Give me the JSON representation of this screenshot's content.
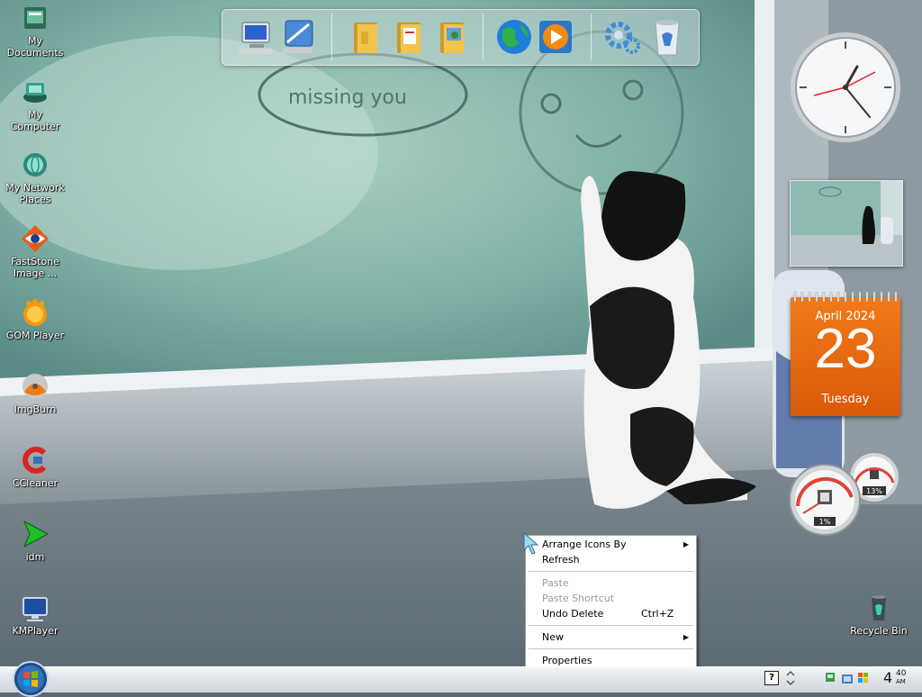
{
  "desktop_icons": [
    {
      "label": "My\nDocuments",
      "icon": "folder-documents-icon"
    },
    {
      "label": "My\nComputer",
      "icon": "computer-icon"
    },
    {
      "label": "My Network\nPlaces",
      "icon": "network-globe-icon"
    },
    {
      "label": "FastStone\nImage ...",
      "icon": "faststone-eye-icon"
    },
    {
      "label": "GOM Player",
      "icon": "gom-player-icon"
    },
    {
      "label": "ImgBurn",
      "icon": "imgburn-disc-icon"
    },
    {
      "label": "CCleaner",
      "icon": "ccleaner-icon"
    },
    {
      "label": "idm",
      "icon": "idm-arrow-icon"
    },
    {
      "label": "KMPlayer",
      "icon": "kmplayer-icon"
    }
  ],
  "recycle_bin": {
    "label": "Recycle Bin"
  },
  "wallpaper": {
    "drawn_text": "missing you"
  },
  "dock": {
    "items": [
      "my-computer-icon",
      "control-panel-icon",
      "folder-icon",
      "documents-folder-icon",
      "pictures-folder-icon",
      "internet-globe-icon",
      "media-player-icon",
      "settings-gears-icon",
      "recycle-bin-icon"
    ]
  },
  "calendar": {
    "month_year": "April 2024",
    "day": "23",
    "weekday": "Tuesday"
  },
  "meters": {
    "cpu": "1%",
    "memory": "13%"
  },
  "context_menu": {
    "arrange_icons": "Arrange Icons By",
    "refresh": "Refresh",
    "paste": "Paste",
    "paste_shortcut": "Paste Shortcut",
    "undo_delete": "Undo Delete",
    "undo_shortcut": "Ctrl+Z",
    "new": "New",
    "properties": "Properties"
  },
  "taskbar": {
    "help_glyph": "?",
    "time_hour": "4",
    "time_min": "40",
    "time_ampm": "AM"
  },
  "colors": {
    "calendar": "#e8690f",
    "taskbar": "#e4e8ec",
    "menu_bg": "#ffffff"
  }
}
